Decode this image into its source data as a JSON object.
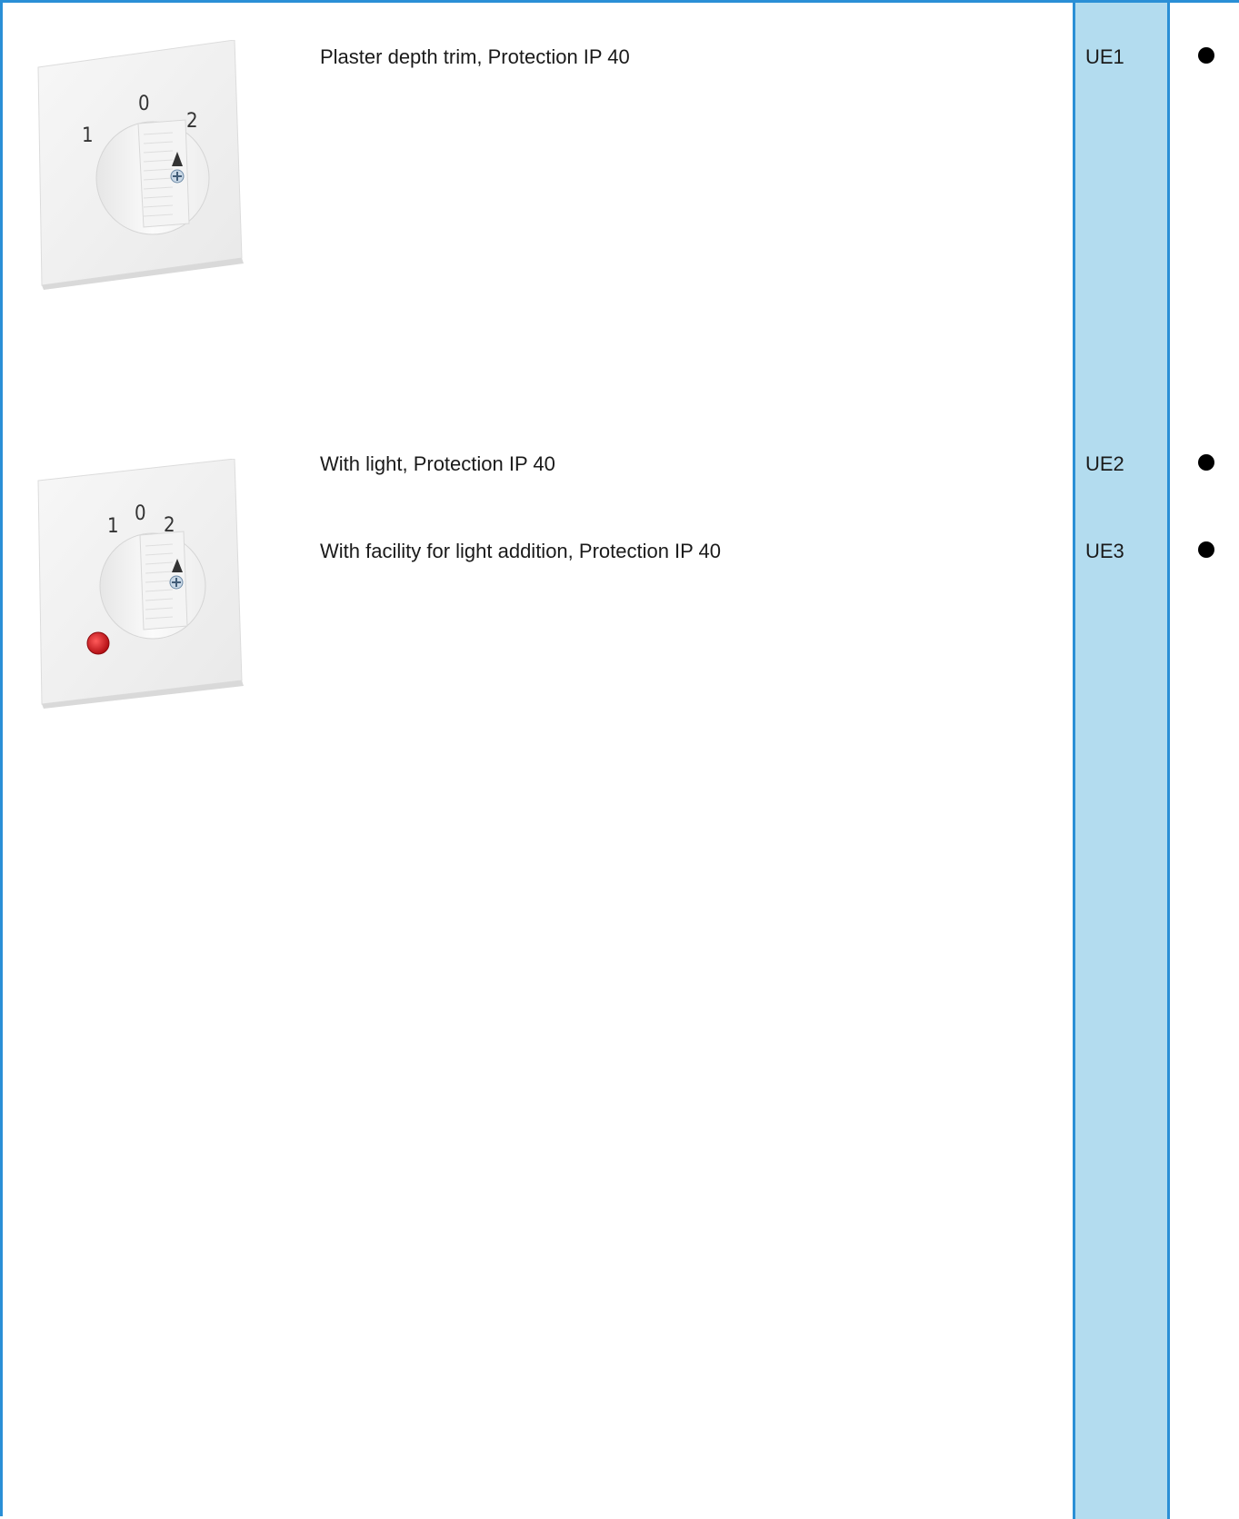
{
  "products": [
    {
      "description": "Plaster depth trim, Protection IP 40",
      "code": "UE1",
      "availability": "●",
      "image": {
        "icon": "rotary-switch-cover-icon",
        "dial_labels": [
          "1",
          "0",
          "2"
        ],
        "has_indicator_light": false
      }
    },
    {
      "description": "With light, Protection IP 40",
      "code": "UE2",
      "availability": "●",
      "image": {
        "icon": "rotary-switch-cover-with-light-icon",
        "dial_labels": [
          "1",
          "0",
          "2"
        ],
        "has_indicator_light": true,
        "indicator_color": "#c8141a"
      }
    },
    {
      "description": "With facility for light addition, Protection IP 40",
      "code": "UE3",
      "availability": "●"
    }
  ],
  "colors": {
    "border": "#2a8fd6",
    "code_column": "#b3dcef"
  }
}
